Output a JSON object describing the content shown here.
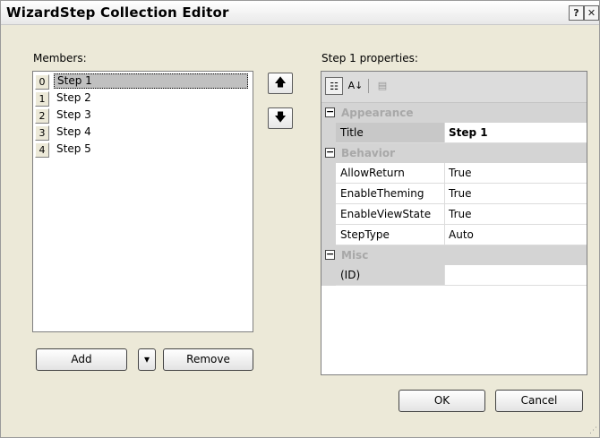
{
  "window": {
    "title": "WizardStep Collection Editor",
    "help_glyph": "?",
    "close_glyph": "✕"
  },
  "members": {
    "label": "Members:",
    "items": [
      {
        "index": "0",
        "label": "Step 1"
      },
      {
        "index": "1",
        "label": "Step 2"
      },
      {
        "index": "2",
        "label": "Step 3"
      },
      {
        "index": "3",
        "label": "Step 4"
      },
      {
        "index": "4",
        "label": "Step 5"
      }
    ],
    "selected_index": 0,
    "move_up_glyph": "🡅",
    "move_down_glyph": "🡇"
  },
  "buttons": {
    "add": "Add",
    "add_dropdown_glyph": "▾",
    "remove": "Remove",
    "ok": "OK",
    "cancel": "Cancel"
  },
  "properties": {
    "label": "Step 1 properties:",
    "categories": [
      {
        "name": "Appearance",
        "toggle": "−",
        "rows": [
          {
            "name": "Title",
            "value": "Step 1",
            "bold": true
          }
        ]
      },
      {
        "name": "Behavior",
        "toggle": "−",
        "rows": [
          {
            "name": "AllowReturn",
            "value": "True"
          },
          {
            "name": "EnableTheming",
            "value": "True"
          },
          {
            "name": "EnableViewState",
            "value": "True"
          },
          {
            "name": "StepType",
            "value": "Auto"
          }
        ]
      },
      {
        "name": "Misc",
        "toggle": "−",
        "rows": [
          {
            "name": "(ID)",
            "value": ""
          }
        ]
      }
    ],
    "toolbar": {
      "categorized_glyph": "☷",
      "alphabetical_glyph": "A↓",
      "property_pages_glyph": "▤"
    }
  }
}
